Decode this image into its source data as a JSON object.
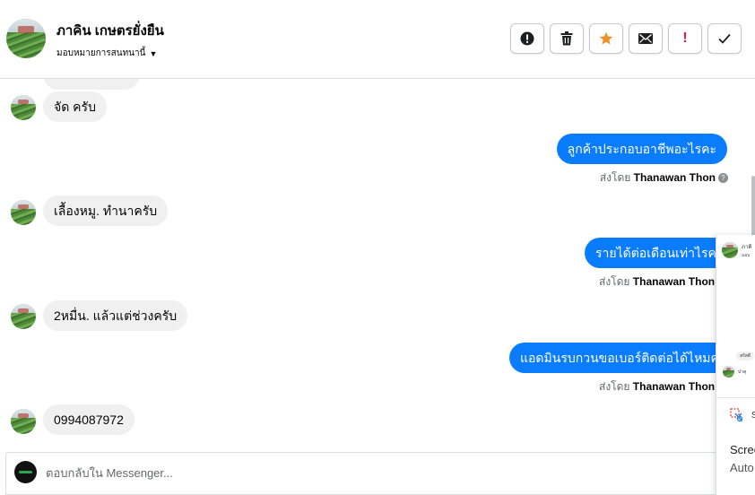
{
  "contact": {
    "name": "ภาคิน เกษตรยั่งยืน",
    "assign_label": "มอบหมายการสนทนานี้",
    "avatar_icon": "contact-avatar"
  },
  "actions": [
    {
      "name": "spam-button",
      "icon": "alert-circle-icon",
      "glyph": "!"
    },
    {
      "name": "delete-button",
      "icon": "trash-icon",
      "glyph": "🗑"
    },
    {
      "name": "star-button",
      "icon": "star-icon",
      "glyph": "★"
    },
    {
      "name": "mark-unread-button",
      "icon": "envelope-icon",
      "glyph": "✉"
    },
    {
      "name": "follow-up-button",
      "icon": "exclamation-icon",
      "glyph": "!"
    },
    {
      "name": "done-button",
      "icon": "check-icon",
      "glyph": "✓"
    }
  ],
  "messages": [
    {
      "dir": "in",
      "text": "จัด ครับ"
    },
    {
      "dir": "out",
      "text": "ลูกค้าประกอบอาชีพอะไรคะ",
      "sent_by_prefix": "ส่งโดย",
      "sent_by": "Thanawan Thon"
    },
    {
      "dir": "in",
      "text": "เลื้องหมู. ทำนาครับ"
    },
    {
      "dir": "out",
      "text": "รายได้ต่อเดือนเท่าไรคะ",
      "sent_by_prefix": "ส่งโดย",
      "sent_by": "Thanawan Thon"
    },
    {
      "dir": "in",
      "text": "2หมื่น. แล้วแต่ช่วงครับ"
    },
    {
      "dir": "out",
      "text": "แอดมินรบกวนขอเบอร์ติดต่อได้ไหมคะ",
      "sent_by_prefix": "ส่งโดย",
      "sent_by": "Thanawan Thon"
    },
    {
      "dir": "in",
      "text": "0994087972"
    }
  ],
  "help_icon": "question-circle-icon",
  "composer": {
    "placeholder": "ตอบกลับใน Messenger..."
  },
  "overlay": {
    "line_a": "ภาคิ",
    "line_b": "มอบ",
    "chip": "สรัสดี",
    "line_c": "ปาคุ",
    "s_label": "S",
    "screen_1": "Scree",
    "screen_2": "Auto"
  },
  "colors": {
    "outgoing_bubble": "#0a7cff",
    "incoming_bubble": "#f0f0f0",
    "star": "#f0922a",
    "follow_up": "#e41e3f"
  }
}
